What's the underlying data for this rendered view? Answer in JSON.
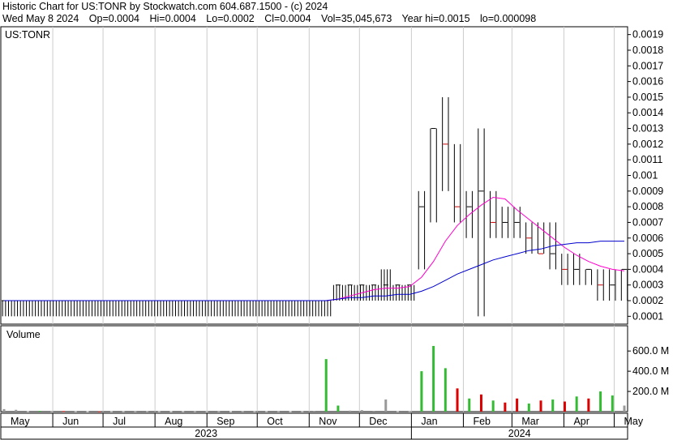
{
  "header": {
    "title": "Historic Chart for US:TONR by Stockwatch.com 604.687.1500 - (c) 2024",
    "date": "Wed May  8 2024",
    "open": "Op=0.0004",
    "high": "Hi=0.0004",
    "low": "Lo=0.0002",
    "close": "Cl=0.0004",
    "volume": "Vol=35,045,673",
    "year_high": "Year hi=0.0015",
    "year_low": "lo=0.000098"
  },
  "colors": {
    "price_bar": "#000000",
    "down_mark": "#cc0000",
    "ma_short": "#ff00cc",
    "ma_long": "#0000cc",
    "vol_up": "#33bb33",
    "vol_down": "#dd0000",
    "vol_flat": "#999999",
    "grid": "#cccccc"
  },
  "chart_data": [
    {
      "type": "line",
      "label": "US:TONR",
      "x_unit": "trading week (May 2023 to May 2024)",
      "ylim": [
        5e-05,
        0.00195
      ],
      "y_ticks": [
        0.0019,
        0.0018,
        0.0017,
        0.0016,
        0.0015,
        0.0014,
        0.0013,
        0.0012,
        0.0011,
        0.001,
        0.0009,
        0.0008,
        0.0007,
        0.0006,
        0.0005,
        0.0004,
        0.0003,
        0.0002,
        0.0001
      ],
      "y_tick_labels": [
        "0.0019",
        "0.0018",
        "0.0017",
        "0.0016",
        "0.0015",
        "0.0014",
        "0.0013",
        "0.0012",
        "0.0011",
        "0.001",
        "0.0009",
        "0.0008",
        "0.0007",
        "0.0006",
        "0.0005",
        "0.0004",
        "0.0003",
        "0.0002",
        "0.0001"
      ],
      "x_ticks": [
        {
          "label": "May",
          "day": 0
        },
        {
          "label": "Jun",
          "day": 31
        },
        {
          "label": "Jul",
          "day": 61
        },
        {
          "label": "Aug",
          "day": 92
        },
        {
          "label": "Sep",
          "day": 123
        },
        {
          "label": "Oct",
          "day": 153
        },
        {
          "label": "Nov",
          "day": 184
        },
        {
          "label": "Dec",
          "day": 214
        },
        {
          "label": "Jan",
          "day": 245
        },
        {
          "label": "Feb",
          "day": 276
        },
        {
          "label": "Mar",
          "day": 305
        },
        {
          "label": "Apr",
          "day": 336
        },
        {
          "label": "May",
          "day": 366
        }
      ],
      "years": [
        {
          "label": "2023",
          "start": 0,
          "end": 245
        },
        {
          "label": "2024",
          "start": 245,
          "end": 374
        }
      ],
      "series": [
        {
          "name": "price_high",
          "values": [
            0.0002,
            0.0002,
            0.0002,
            0.0002,
            0.0002,
            0.0002,
            0.0002,
            0.0002,
            0.0002,
            0.0002,
            0.0002,
            0.0002,
            0.0002,
            0.0002,
            0.0002,
            0.0002,
            0.0002,
            0.0002,
            0.0002,
            0.0002,
            0.0002,
            0.0002,
            0.0002,
            0.0002,
            0.0002,
            0.0002,
            0.0002,
            0.0002,
            0.0003,
            0.0003,
            0.0003,
            0.0003,
            0.0004,
            0.0003,
            0.0003,
            0.0009,
            0.0013,
            0.0015,
            0.0012,
            0.0009,
            0.0013,
            0.0009,
            0.0008,
            0.0008,
            0.0007,
            0.0007,
            0.0007,
            0.0005,
            0.0005,
            0.0004,
            0.0004,
            0.0004,
            0.0004
          ]
        },
        {
          "name": "price_low",
          "values": [
            0.0001,
            0.0001,
            0.0001,
            0.0001,
            0.0001,
            0.0001,
            0.0001,
            0.0001,
            0.0001,
            0.0001,
            0.0001,
            0.0001,
            0.0001,
            0.0001,
            0.0001,
            0.0001,
            0.0001,
            0.0001,
            0.0001,
            0.0001,
            0.0001,
            0.0001,
            0.0001,
            0.0001,
            0.0001,
            0.0001,
            0.0001,
            0.0001,
            0.0002,
            0.0002,
            0.0002,
            0.0002,
            0.0002,
            0.0002,
            0.0002,
            0.0004,
            0.0007,
            0.0009,
            0.0007,
            0.0006,
            0.0001,
            0.0006,
            0.0006,
            0.0006,
            0.0005,
            0.0005,
            0.0004,
            0.0003,
            0.0003,
            0.0003,
            0.0002,
            0.0002,
            0.0002
          ]
        },
        {
          "name": "price_close",
          "values": [
            0.0002,
            0.0002,
            0.0002,
            0.0002,
            0.0002,
            0.0002,
            0.0002,
            0.0002,
            0.0002,
            0.0002,
            0.0002,
            0.0002,
            0.0002,
            0.0002,
            0.0002,
            0.0002,
            0.0002,
            0.0002,
            0.0002,
            0.0002,
            0.0002,
            0.0002,
            0.0002,
            0.0002,
            0.0002,
            0.0002,
            0.0002,
            0.0002,
            0.0003,
            0.0003,
            0.0003,
            0.0003,
            0.0003,
            0.0003,
            0.0003,
            0.0008,
            0.0013,
            0.0012,
            0.0008,
            0.0008,
            0.0009,
            0.0007,
            0.0007,
            0.0007,
            0.0006,
            0.0005,
            0.0005,
            0.0004,
            0.0004,
            0.0004,
            0.0003,
            0.0003,
            0.0004
          ]
        },
        {
          "name": "ma_short",
          "values": [
            0.0002,
            0.0002,
            0.0002,
            0.0002,
            0.0002,
            0.0002,
            0.0002,
            0.0002,
            0.0002,
            0.0002,
            0.0002,
            0.0002,
            0.0002,
            0.0002,
            0.0002,
            0.0002,
            0.0002,
            0.0002,
            0.0002,
            0.0002,
            0.0002,
            0.0002,
            0.0002,
            0.0002,
            0.0002,
            0.0002,
            0.0002,
            0.0002,
            0.00021,
            0.00023,
            0.00025,
            0.00027,
            0.00028,
            0.00028,
            0.00029,
            0.00035,
            0.00045,
            0.00058,
            0.00068,
            0.00075,
            0.00081,
            0.00086,
            0.00085,
            0.00078,
            0.00072,
            0.00066,
            0.0006,
            0.00054,
            0.00049,
            0.00045,
            0.00042,
            0.0004,
            0.00039
          ]
        },
        {
          "name": "ma_long",
          "values": [
            0.0002,
            0.0002,
            0.0002,
            0.0002,
            0.0002,
            0.0002,
            0.0002,
            0.0002,
            0.0002,
            0.0002,
            0.0002,
            0.0002,
            0.0002,
            0.0002,
            0.0002,
            0.0002,
            0.0002,
            0.0002,
            0.0002,
            0.0002,
            0.0002,
            0.0002,
            0.0002,
            0.0002,
            0.0002,
            0.0002,
            0.0002,
            0.0002,
            0.00021,
            0.00022,
            0.00022,
            0.00023,
            0.00023,
            0.00024,
            0.00024,
            0.00026,
            0.00029,
            0.00033,
            0.00037,
            0.0004,
            0.00043,
            0.00046,
            0.00048,
            0.0005,
            0.00052,
            0.00053,
            0.00055,
            0.00056,
            0.00057,
            0.00057,
            0.00058,
            0.00058,
            0.00058
          ]
        }
      ]
    },
    {
      "type": "bar",
      "label": "Volume",
      "ylim": [
        0,
        850
      ],
      "y_ticks": [
        200,
        400,
        600
      ],
      "y_tick_labels": [
        "200.0 M",
        "400.0 M",
        "600.0 M"
      ],
      "series": [
        {
          "name": "volume",
          "values": [
            25,
            18,
            5,
            8,
            2,
            6,
            3,
            4,
            2,
            3,
            5,
            2,
            6,
            3,
            4,
            5,
            2,
            3,
            2,
            4,
            6,
            3,
            5,
            2,
            4,
            3,
            8,
            520,
            60,
            10,
            15,
            8,
            120,
            5,
            6,
            400,
            650,
            430,
            230,
            130,
            170,
            110,
            90,
            130,
            80,
            110,
            120,
            100,
            150,
            130,
            200,
            160,
            60
          ]
        },
        {
          "name": "direction",
          "values": [
            "flat",
            "flat",
            "flat",
            "up",
            "flat",
            "down",
            "flat",
            "flat",
            "down",
            "flat",
            "flat",
            "flat",
            "flat",
            "flat",
            "flat",
            "flat",
            "flat",
            "flat",
            "flat",
            "flat",
            "flat",
            "flat",
            "flat",
            "flat",
            "flat",
            "flat",
            "flat",
            "up",
            "up",
            "flat",
            "flat",
            "flat",
            "flat",
            "flat",
            "flat",
            "up",
            "up",
            "up",
            "down",
            "up",
            "down",
            "up",
            "down",
            "down",
            "up",
            "down",
            "up",
            "down",
            "up",
            "down",
            "up",
            "up",
            "flat"
          ]
        }
      ]
    }
  ]
}
